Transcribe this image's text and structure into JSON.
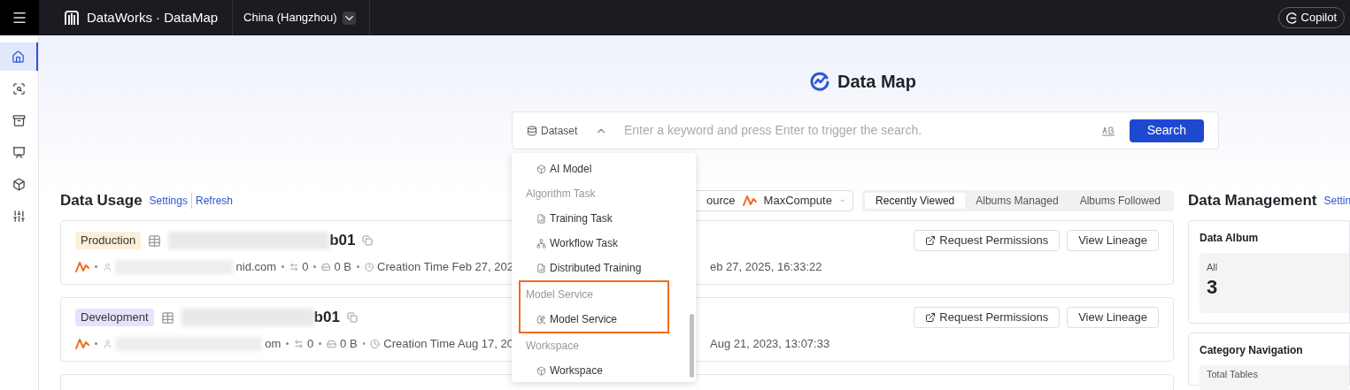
{
  "topbar": {
    "brand": "DataWorks · DataMap",
    "region": "China (Hangzhou)",
    "copilot": "Copilot"
  },
  "sidebar": {
    "items": [
      {
        "kind": "home",
        "selected": true
      },
      {
        "kind": "search",
        "selected": false
      },
      {
        "kind": "archive",
        "selected": false
      },
      {
        "kind": "monitor",
        "selected": false
      },
      {
        "kind": "model",
        "selected": false
      },
      {
        "kind": "sliders",
        "selected": false
      }
    ]
  },
  "hero": {
    "title": "Data Map",
    "search": {
      "scope": "Dataset",
      "placeholder": "Enter a keyword and press Enter to trigger the search.",
      "button": "Search"
    }
  },
  "dropdown": {
    "sections": [
      {
        "highlighted": false,
        "items": [
          {
            "kind": "model",
            "label": "AI Model"
          }
        ]
      },
      {
        "title": "Algorithm Task",
        "highlighted": false,
        "items": [
          {
            "kind": "task",
            "label": "Training Task"
          },
          {
            "kind": "workflow",
            "label": "Workflow Task"
          },
          {
            "kind": "task",
            "label": "Distributed Training"
          }
        ]
      },
      {
        "title": "Model Service",
        "highlighted": true,
        "items": [
          {
            "kind": "service",
            "label": "Model Service"
          }
        ]
      },
      {
        "title": "Workspace",
        "highlighted": false,
        "items": [
          {
            "kind": "model",
            "label": "Workspace"
          }
        ]
      }
    ]
  },
  "data_usage": {
    "title": "Data Usage",
    "links": [
      "Settings",
      "Refresh"
    ],
    "filter": {
      "label": "ource",
      "value": "MaxCompute"
    },
    "tabs": [
      {
        "label": "Recently Viewed",
        "selected": true
      },
      {
        "label": "Albums Managed",
        "selected": false
      },
      {
        "label": "Albums Followed",
        "selected": false
      }
    ],
    "rows": [
      {
        "env": "Production",
        "color": "#fcefd9",
        "name_tail": "b01",
        "owner_tail": "nid.com",
        "lineage": "0",
        "size": "0 B",
        "created": "Creation Time Feb 27, 202",
        "modified_tail": "eb 27, 2025, 16:33:22",
        "actions": [
          "Request Permissions",
          "View Lineage"
        ]
      },
      {
        "env": "Development",
        "color": "#e7e2fb",
        "name_tail": "b01",
        "owner_tail": "om",
        "lineage": "0",
        "size": "0 B",
        "created": "Creation Time Aug 17, 20",
        "modified_tail": "Aug 21, 2023, 13:07:33",
        "actions": [
          "Request Permissions",
          "View Lineage"
        ]
      }
    ]
  },
  "data_management": {
    "title": "Data Management",
    "link": "Settin",
    "album": {
      "title": "Data Album",
      "label": "All",
      "count": "3"
    },
    "category": {
      "title": "Category Navigation",
      "label": "Total Tables"
    }
  }
}
